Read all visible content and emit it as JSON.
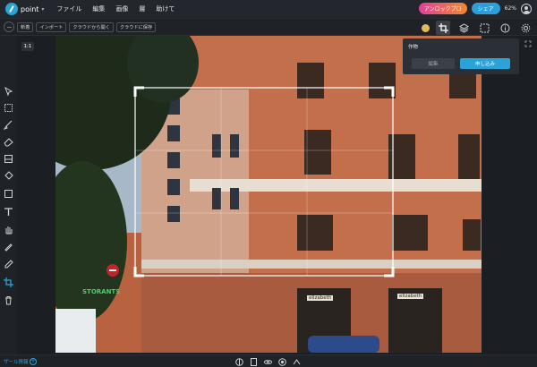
{
  "app": {
    "name": "point"
  },
  "menu": {
    "items": [
      "ファイル",
      "編集",
      "画像",
      "層",
      "助けて"
    ]
  },
  "header": {
    "unlock_label": "アンロックプロ",
    "share_label": "シェア",
    "zoom": "62%"
  },
  "toolbar": {
    "buttons": [
      "新着",
      "インポート",
      "クラウドから開く",
      "クラウドに保存"
    ]
  },
  "crop": {
    "ratio_label": "1:1"
  },
  "panel": {
    "title": "作物",
    "cancel_label": "編集",
    "apply_label": "申し込み"
  },
  "status": {
    "text": "ザール情報"
  },
  "canvas": {
    "signs": {
      "storefront": "STORANTS",
      "shop1": "elizabeth",
      "shop2": "elizabeth"
    }
  },
  "colors": {
    "accent": "#2aa3d8",
    "unlock_start": "#e0409a",
    "unlock_end": "#f38a2a",
    "swatch": "#e5b85a"
  },
  "icons": [
    "logo-icon",
    "user-icon",
    "swatch-icon",
    "crop-icon",
    "layers-icon",
    "info-icon",
    "settings-icon",
    "pointer-icon",
    "marquee-icon",
    "brush-icon",
    "eraser-icon",
    "fill-icon",
    "bucket-icon",
    "rectangle-icon",
    "text-icon",
    "hand-icon",
    "clone-icon",
    "eyedropper-icon",
    "crop-tool-icon",
    "trash-icon",
    "expand-icon"
  ]
}
